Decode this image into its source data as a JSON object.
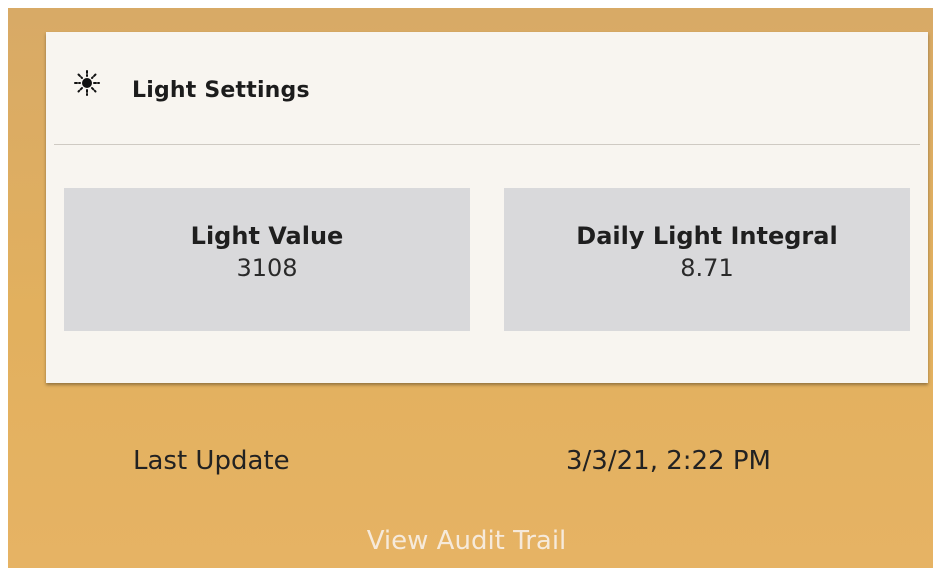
{
  "card": {
    "icon": "sun-icon",
    "title": "Light Settings"
  },
  "metrics": [
    {
      "label": "Light Value",
      "value": "3108"
    },
    {
      "label": "Daily Light Integral",
      "value": "8.71"
    }
  ],
  "footer": {
    "last_update_label": "Last Update",
    "last_update_value": "3/3/21, 2:22 PM",
    "audit_link": "View Audit Trail"
  },
  "colors": {
    "tile_background": "#e2b05e",
    "card_background": "#f8f5f0",
    "metric_background": "#d9d9db",
    "link_text": "#f6eadb"
  }
}
